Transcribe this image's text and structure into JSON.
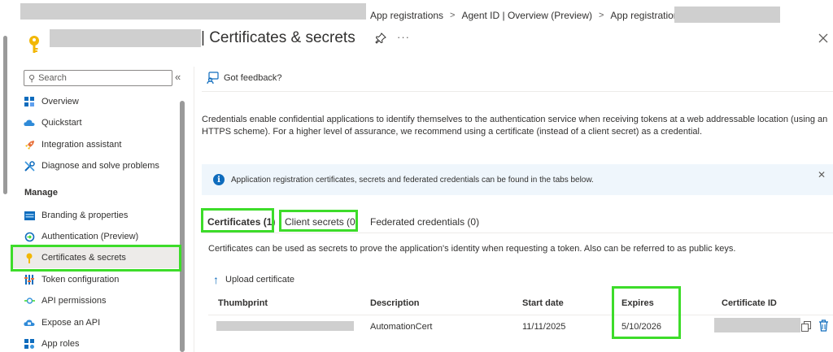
{
  "breadcrumb": {
    "items": [
      "App registrations",
      "Agent ID | Overview (Preview)",
      "App registrations"
    ],
    "separator": ">"
  },
  "header": {
    "title": "| Certificates & secrets",
    "more": "···"
  },
  "sidebar": {
    "search_placeholder": "Search",
    "collapse_glyph": "«",
    "items_top": [
      {
        "label": "Overview",
        "icon": "overview-grid-icon"
      },
      {
        "label": "Quickstart",
        "icon": "cloud-icon"
      },
      {
        "label": "Integration assistant",
        "icon": "rocket-icon"
      },
      {
        "label": "Diagnose and solve problems",
        "icon": "wrench-icon"
      }
    ],
    "section_manage": "Manage",
    "items_manage": [
      {
        "label": "Branding & properties",
        "icon": "branding-icon"
      },
      {
        "label": "Authentication (Preview)",
        "icon": "authentication-icon"
      },
      {
        "label": "Certificates & secrets",
        "icon": "key-icon",
        "selected": true
      },
      {
        "label": "Token configuration",
        "icon": "token-bars-icon"
      },
      {
        "label": "API permissions",
        "icon": "permissions-icon"
      },
      {
        "label": "Expose an API",
        "icon": "cloud-api-icon"
      },
      {
        "label": "App roles",
        "icon": "app-roles-icon"
      }
    ]
  },
  "main": {
    "feedback": "Got feedback?",
    "description": "Credentials enable confidential applications to identify themselves to the authentication service when receiving tokens at a web addressable location (using an HTTPS scheme). For a higher level of assurance, we recommend using a certificate (instead of a client secret) as a credential.",
    "info": "Application registration certificates, secrets and federated credentials can be found in the tabs below.",
    "info_close": "✕",
    "tabs": [
      {
        "label": "Certificates (1)",
        "active": true
      },
      {
        "label": "Client secrets (0)",
        "active": false
      },
      {
        "label": "Federated credentials (0)",
        "active": false
      }
    ],
    "cert_note": "Certificates can be used as secrets to prove the application's identity when requesting a token. Also can be referred to as public keys.",
    "upload_label": "Upload certificate",
    "table": {
      "columns": [
        "Thumbprint",
        "Description",
        "Start date",
        "Expires",
        "Certificate ID"
      ],
      "rows": [
        {
          "description": "AutomationCert",
          "start_date": "11/11/2025",
          "expires": "5/10/2026"
        }
      ]
    }
  },
  "colors": {
    "accent": "#0f6cbd",
    "highlight": "#3ddc2a",
    "selected_bg": "#edebe9",
    "info_bg": "#eff6fc"
  }
}
